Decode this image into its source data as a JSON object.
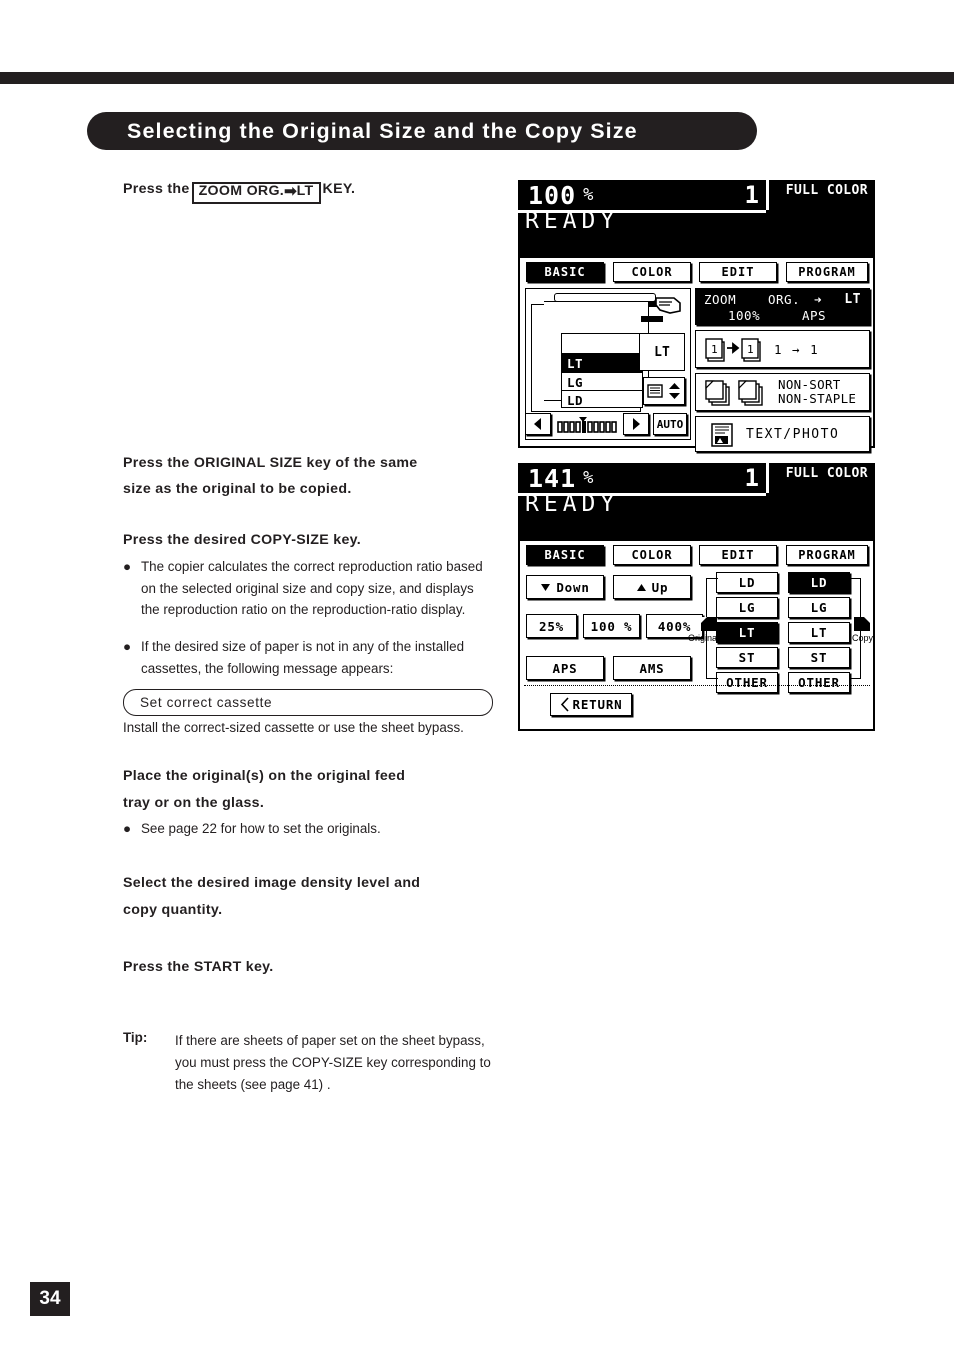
{
  "page": {
    "number": "34",
    "title": "Selecting the Original Size and the Copy Size"
  },
  "steps": {
    "step1": {
      "prefix": "Press the",
      "key_label_1": "ZOOM ORG.",
      "key_arrow": "➡",
      "key_label_2": "LT",
      "suffix": "KEY."
    },
    "step2": {
      "heading_line1": "Press the ORIGINAL SIZE key of the same",
      "heading_line2": "size as the original to be copied."
    },
    "step3": {
      "heading": "Press the desired COPY-SIZE key.",
      "bullet1": "The copier calculates the correct reproduction ratio based on the selected original size and copy size, and displays the reproduction ratio on the reproduction-ratio display.",
      "bullet2": "If the desired size of paper is not in any of the installed cassettes, the following message appears:",
      "message_box": "Set correct cassette",
      "after_message": "Install the correct-sized cassette or use the sheet bypass."
    },
    "step4": {
      "heading_line1": "Place the original(s) on the original feed",
      "heading_line2": "tray or on the glass.",
      "bullet1": "See page 22 for how to set the originals."
    },
    "step5": {
      "heading_line1": "Select the desired image density level and",
      "heading_line2": "copy quantity."
    },
    "step6": {
      "heading": "Press the START key."
    },
    "tip": {
      "label": "Tip:",
      "text": "If there are sheets of paper set on the sheet bypass, you must press the COPY-SIZE key corresponding to the sheets (see page 41) ."
    }
  },
  "lcd1": {
    "ratio": "100",
    "percent": "%",
    "quantity": "1",
    "color_mode": "FULL COLOR",
    "status": "READY",
    "tabs": [
      {
        "label": "BASIC",
        "active": true
      },
      {
        "label": "COLOR",
        "active": false
      },
      {
        "label": "EDIT",
        "active": false
      },
      {
        "label": "PROGRAM",
        "active": false
      }
    ],
    "cassettes": [
      {
        "label": "LT",
        "selected": true
      },
      {
        "label": "LG",
        "selected": false
      },
      {
        "label": "LD",
        "selected": false
      }
    ],
    "bypass_size": "LT",
    "auto_label": "AUTO",
    "zoom_button": {
      "left": "ZOOM",
      "center": "ORG.",
      "arrow": "➜",
      "right": "LT",
      "value": "100%",
      "mode": "APS"
    },
    "duplex_button": {
      "label": "1 → 1"
    },
    "finish_button": {
      "line1": "NON-SORT",
      "line2": "NON-STAPLE"
    },
    "mode_button": {
      "label": "TEXT/PHOTO"
    }
  },
  "lcd2": {
    "ratio": "141",
    "percent": "%",
    "quantity": "1",
    "color_mode": "FULL COLOR",
    "status": "READY",
    "tabs": [
      {
        "label": "BASIC",
        "active": true
      },
      {
        "label": "COLOR",
        "active": false
      },
      {
        "label": "EDIT",
        "active": false
      },
      {
        "label": "PROGRAM",
        "active": false
      }
    ],
    "down_button": "Down",
    "up_button": "Up",
    "preset_buttons": [
      "25%",
      "100 %",
      "400%"
    ],
    "aps_button": "APS",
    "ams_button": "AMS",
    "return_button": "RETURN",
    "original_label": "Original",
    "copy_label": "Copy",
    "original_sizes": [
      {
        "label": "LD",
        "selected": false
      },
      {
        "label": "LG",
        "selected": false
      },
      {
        "label": "LT",
        "selected": true
      },
      {
        "label": "ST",
        "selected": false
      },
      {
        "label": "OTHER",
        "selected": false
      }
    ],
    "copy_sizes": [
      {
        "label": "LD",
        "selected": true
      },
      {
        "label": "LG",
        "selected": false
      },
      {
        "label": "LT",
        "selected": false
      },
      {
        "label": "ST",
        "selected": false
      },
      {
        "label": "OTHER",
        "selected": false
      }
    ]
  },
  "colors": {
    "ink": "#231f20",
    "paper": "#ffffff"
  }
}
